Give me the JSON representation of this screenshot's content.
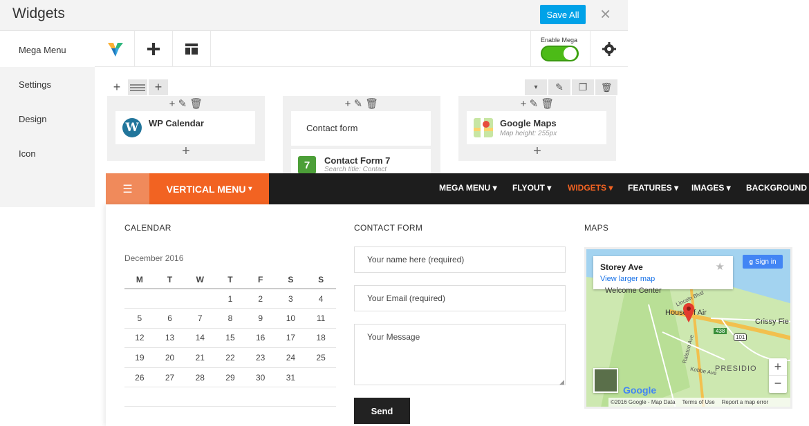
{
  "admin": {
    "title": "Widgets",
    "save_label": "Save All",
    "close_icon": "×",
    "sidebar": [
      "Mega Menu",
      "Settings",
      "Design",
      "Icon"
    ],
    "enable_mega_label": "Enable Mega",
    "enable_mega_on": true,
    "columns": [
      {
        "widgets": [
          {
            "name": "WP Calendar",
            "sub": ""
          }
        ]
      },
      {
        "widgets": [
          {
            "name": "Contact form",
            "sub": ""
          },
          {
            "name": "Contact Form 7",
            "sub": "Search title: Contact"
          }
        ]
      },
      {
        "widgets": [
          {
            "name": "Google Maps",
            "sub": "Map height: 255px"
          }
        ]
      }
    ]
  },
  "nav": {
    "vertical_menu": "VERTICAL MENU",
    "items": [
      "MEGA MENU",
      "FLYOUT",
      "WIDGETS",
      "FEATURES",
      "IMAGES",
      "BACKGROUND"
    ],
    "active": "WIDGETS",
    "accent": "#f26322"
  },
  "calendar": {
    "title": "CALENDAR",
    "month": "December 2016",
    "days": [
      "M",
      "T",
      "W",
      "T",
      "F",
      "S",
      "S"
    ],
    "weeks": [
      [
        "",
        "",
        "",
        "1",
        "2",
        "3",
        "4"
      ],
      [
        "5",
        "6",
        "7",
        "8",
        "9",
        "10",
        "11"
      ],
      [
        "12",
        "13",
        "14",
        "15",
        "16",
        "17",
        "18"
      ],
      [
        "19",
        "20",
        "21",
        "22",
        "23",
        "24",
        "25"
      ],
      [
        "26",
        "27",
        "28",
        "29",
        "30",
        "31",
        ""
      ]
    ]
  },
  "contact": {
    "title": "CONTACT FORM",
    "name_placeholder": "Your name here (required)",
    "email_placeholder": "Your Email (required)",
    "message_placeholder": "Your Message",
    "send_label": "Send"
  },
  "maps": {
    "title": "MAPS",
    "place": "Storey Ave",
    "larger_link": "View larger map",
    "sign_in": "Sign in",
    "labels": [
      "Welcome Center",
      "House of Air",
      "Crissy Fie",
      "PRESIDIO",
      "Lincoln Blvd",
      "Kobbe Ave",
      "Ralston Ave",
      "438",
      "101"
    ],
    "google": "Google",
    "footer": [
      "©2016 Google - Map Data",
      "Terms of Use",
      "Report a map error"
    ]
  }
}
